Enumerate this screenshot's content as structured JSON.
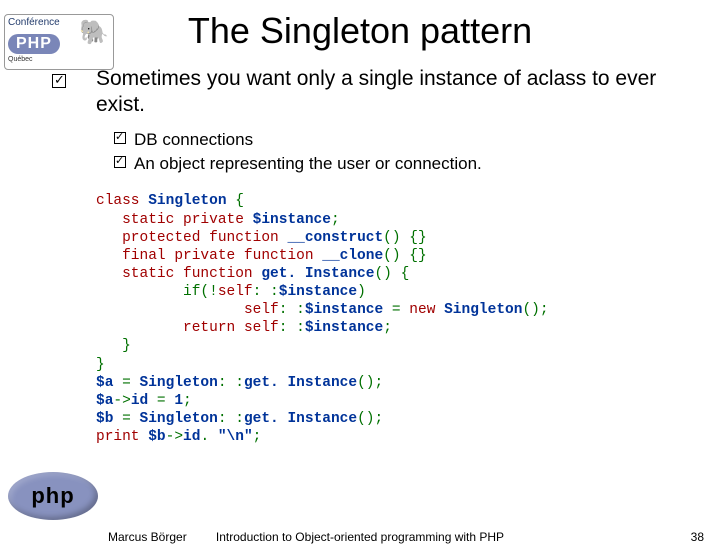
{
  "logo": {
    "conference_label": "Conférence",
    "php_text": "PHP",
    "region": "Québec"
  },
  "title": "The Singleton pattern",
  "main_point": "Sometimes you want only a single instance of aclass to ever exist.",
  "sub_points": [
    "DB connections",
    "An object representing the user or connection."
  ],
  "code": {
    "l1_kw1": "class",
    "l1_cls": "Singleton",
    "l1_brace": " {",
    "l2_kw": "static private",
    "l2_var": "$instance",
    "l2_end": ";",
    "l3_kw": "protected function",
    "l3_fn": "__construct",
    "l3_rest": "() {}",
    "l4_kw": "final private function",
    "l4_fn": "__clone",
    "l4_rest": "() {}",
    "l5_kw": "static function",
    "l5_fn": "get. Instance",
    "l5_rest": "() {",
    "l6_a": "if(!",
    "l6_b": "self",
    "l6_c": ": :",
    "l6_var": "$instance",
    "l6_d": ")",
    "l7_a": "self",
    "l7_b": ": :",
    "l7_var": "$instance",
    "l7_eq": " = ",
    "l7_kw": "new",
    "l7_cls": "Singleton",
    "l7_end": "();",
    "l8_kw": "return",
    "l8_a": "self",
    "l8_b": ": :",
    "l8_var": "$instance",
    "l8_end": ";",
    "l9": "   }",
    "l10": "}",
    "l11_var": "$a",
    "l11_eq": " = ",
    "l11_cls": "Singleton",
    "l11_dd": ": :",
    "l11_fn": "get. Instance",
    "l11_end": "();",
    "l12_vara": "$a",
    "l12_arrow": "->",
    "l12_id": "id",
    "l12_eq": " = ",
    "l12_num": "1",
    "l12_end": ";",
    "l13_var": "$b",
    "l13_eq": " = ",
    "l13_cls": "Singleton",
    "l13_dd": ": :",
    "l13_fn": "get. Instance",
    "l13_end": "();",
    "l14_kw": "print",
    "l14_var": "$b",
    "l14_arrow": "->",
    "l14_id": "id",
    "l14_dot": ". ",
    "l14_str": "\"\\n\"",
    "l14_end": ";"
  },
  "footer": {
    "author": "Marcus Börger",
    "subject": "Introduction to Object-oriented programming with PHP",
    "page": "38"
  },
  "php_bottom_logo": "php"
}
